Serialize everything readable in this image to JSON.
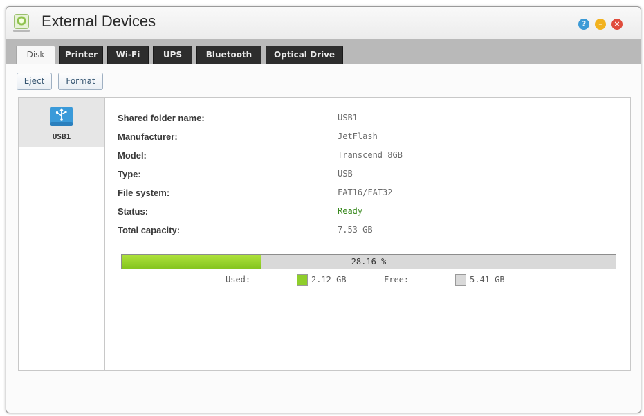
{
  "window": {
    "title": "External Devices",
    "controls": {
      "help": "?",
      "minimize": "–",
      "close": "×"
    }
  },
  "tabs": [
    {
      "label": "Disk",
      "active": true
    },
    {
      "label": "Printer",
      "active": false
    },
    {
      "label": "Wi-Fi",
      "active": false
    },
    {
      "label": "UPS",
      "active": false
    },
    {
      "label": "Bluetooth",
      "active": false
    },
    {
      "label": "Optical Drive",
      "active": false
    }
  ],
  "toolbar": {
    "eject_label": "Eject",
    "format_label": "Format"
  },
  "devices": [
    {
      "name": "USB1",
      "icon": "usb-drive-icon",
      "selected": true
    }
  ],
  "details": {
    "shared_folder": {
      "label": "Shared folder name:",
      "value": "USB1"
    },
    "manufacturer": {
      "label": "Manufacturer:",
      "value": "JetFlash"
    },
    "model": {
      "label": "Model:",
      "value": "Transcend 8GB"
    },
    "type": {
      "label": "Type:",
      "value": "USB"
    },
    "file_system": {
      "label": "File system:",
      "value": "FAT16/FAT32"
    },
    "status": {
      "label": "Status:",
      "value": "Ready"
    },
    "total_capacity": {
      "label": "Total capacity:",
      "value": "7.53 GB"
    }
  },
  "usage": {
    "percent_text": "28.16 %",
    "used_fraction": 0.2816,
    "used_label": "Used:",
    "used_value": "2.12 GB",
    "free_label": "Free:",
    "free_value": "5.41 GB"
  },
  "colors": {
    "used": "#8fce2b",
    "free": "#d9d9d9",
    "status_ready": "#3a8a1f",
    "tab_dark": "#2d2d2d",
    "usb_icon": "#3a9ad9"
  }
}
